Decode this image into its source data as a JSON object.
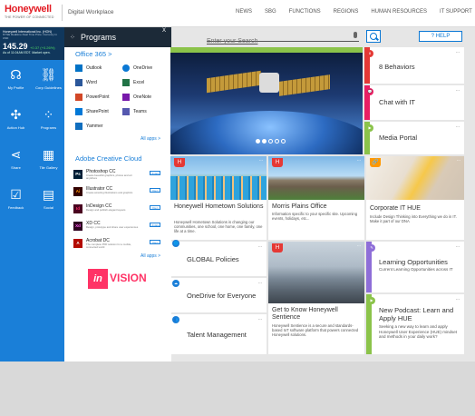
{
  "header": {
    "logo": "Honeywell",
    "logo_tagline": "THE POWER OF CONNECTED",
    "site_name": "Digital Workplace",
    "nav": [
      "NEWS",
      "SBG",
      "FUNCTIONS",
      "REGIONS",
      "HUMAN RESOURCES",
      "IT SUPPORT"
    ]
  },
  "search": {
    "placeholder": "Enter your Search",
    "help_label": "? HELP"
  },
  "stock": {
    "company": "Honeywell International Inc. (HON)",
    "note": "NYSE Realtime Real Time Price. Currency in USD",
    "price": "145.29",
    "change": "+0.37 (+0.26%)",
    "time": "As of 11:04AM EDT. Market open."
  },
  "left_tiles": [
    {
      "label": "My Profile",
      "icon": "user-icon",
      "glyph": "☊"
    },
    {
      "label": "Corp Guidelines",
      "icon": "link-icon",
      "glyph": "⛓"
    },
    {
      "label": "Action Hub",
      "icon": "action-hub-icon",
      "glyph": "✣"
    },
    {
      "label": "Programs",
      "icon": "grid-icon",
      "glyph": "⁘"
    },
    {
      "label": "Share",
      "icon": "share-icon",
      "glyph": "⋖"
    },
    {
      "label": "Tile Gallery",
      "icon": "tile-gallery-icon",
      "glyph": "▦"
    },
    {
      "label": "Feedback",
      "icon": "feedback-icon",
      "glyph": "☑"
    },
    {
      "label": "Social",
      "icon": "social-icon",
      "glyph": "▤"
    }
  ],
  "programs": {
    "title": "Programs",
    "close": "X",
    "office_title": "Office 365 >",
    "office_apps": [
      {
        "name": "Outlook",
        "color": "#0072c6"
      },
      {
        "name": "OneDrive",
        "color": "#0a78d4"
      },
      {
        "name": "Word",
        "color": "#2b579a"
      },
      {
        "name": "Excel",
        "color": "#217346"
      },
      {
        "name": "PowerPoint",
        "color": "#d24726"
      },
      {
        "name": "OneNote",
        "color": "#7719aa"
      },
      {
        "name": "SharePoint",
        "color": "#0078d7"
      },
      {
        "name": "Teams",
        "color": "#5558af"
      },
      {
        "name": "Yammer",
        "color": "#106ebe"
      }
    ],
    "office_all": "All apps >",
    "adobe_title": "Adobe Creative Cloud",
    "adobe_apps": [
      {
        "name": "Photoshop CC",
        "abbr": "Ps",
        "color": "#001e36",
        "desc": "Create beautiful graphics, photos and art anywhere",
        "action": "Update"
      },
      {
        "name": "Illustrator CC",
        "abbr": "Ai",
        "color": "#330000",
        "desc": "Create amazing illustrations and graphics",
        "action": "Open"
      },
      {
        "name": "InDesign CC",
        "abbr": "Id",
        "color": "#49021f",
        "desc": "Design and publish elegant layouts",
        "action": "Open"
      },
      {
        "name": "XD CC",
        "abbr": "Xd",
        "color": "#2e001f",
        "desc": "Design, prototype and share user experiences",
        "action": "Update"
      },
      {
        "name": "Acrobat DC",
        "abbr": "A",
        "color": "#b30b00",
        "desc": "The complete PDF solution for a mobile, connected world",
        "action": "Open"
      }
    ],
    "adobe_all": "All apps >",
    "invision_in": "in",
    "invision_text": "VISION"
  },
  "right_tiles": [
    {
      "title": "8 Behaviors",
      "badge": "8",
      "color": "#e53935"
    },
    {
      "title": "Chat with IT",
      "badge": "💬",
      "color": "#e91e63"
    },
    {
      "title": "Media Portal",
      "badge": "▶",
      "color": "#8bc34a"
    }
  ],
  "cards": [
    {
      "title": "Honeywell Hometown Solutions",
      "desc": "Honeywell Hometown Solutions is changing our communities, one school, one home, one family, one life at a time.",
      "badge": "H"
    },
    {
      "title": "Morris Plains Office",
      "desc": "Information specific to your specific site. Upcoming events, holidays, etc...",
      "badge": "H"
    },
    {
      "title": "Corporate IT HUE",
      "desc": "Include Design Thinking into Everything we do in IT. Make it part of our DNA",
      "badge": "🔗"
    },
    {
      "title": "Get to Know Honeywell Sentience",
      "desc": "Honeywell Sentience is a secure and standards-based IoT software platform that powers connected Honeywell solutions.",
      "badge": "H"
    }
  ],
  "white_tiles": [
    {
      "title": "GLOBAL Policies",
      "badge": "🌐"
    },
    {
      "title": "OneDrive for Everyone",
      "badge": "☁"
    },
    {
      "title": "Talent Management",
      "badge": "👥"
    }
  ],
  "learning": {
    "title": "Learning Opportunities",
    "desc": "Current Learning Opportunities across IT"
  },
  "podcast": {
    "title": "New Podcast: Learn and Apply HUE",
    "desc": "Seeking a new way to learn and apply Honeywell User Experience (HUE) mindset and methods in your daily work?"
  },
  "more_label": "...",
  "carousel_dots": 5
}
